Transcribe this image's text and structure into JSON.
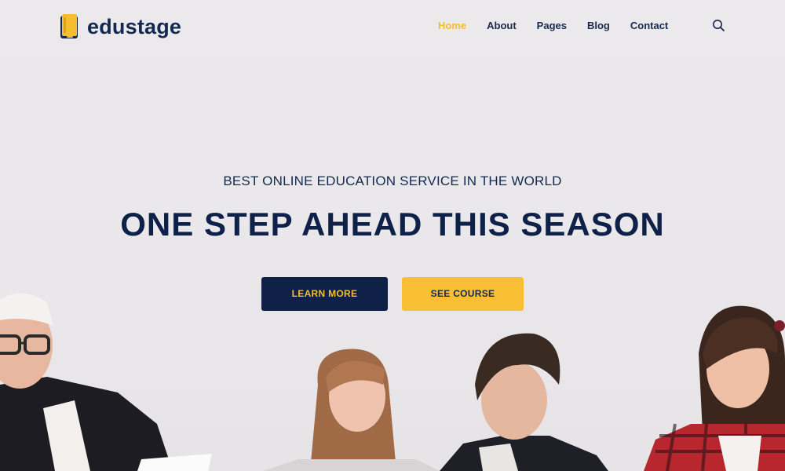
{
  "brand": {
    "name": "edustage",
    "logo_icon": "book-icon",
    "accent": "#f6bd2f",
    "primary": "#0f2149"
  },
  "nav": {
    "items": [
      {
        "label": "Home",
        "active": true
      },
      {
        "label": "About",
        "active": false
      },
      {
        "label": "Pages",
        "active": false
      },
      {
        "label": "Blog",
        "active": false
      },
      {
        "label": "Contact",
        "active": false
      }
    ],
    "search_icon": "search-icon"
  },
  "hero": {
    "eyebrow": "BEST ONLINE EDUCATION SERVICE IN THE WORLD",
    "headline": "ONE STEP AHEAD THIS SEASON",
    "primary_button": "LEARN MORE",
    "secondary_button": "SEE COURSE"
  }
}
